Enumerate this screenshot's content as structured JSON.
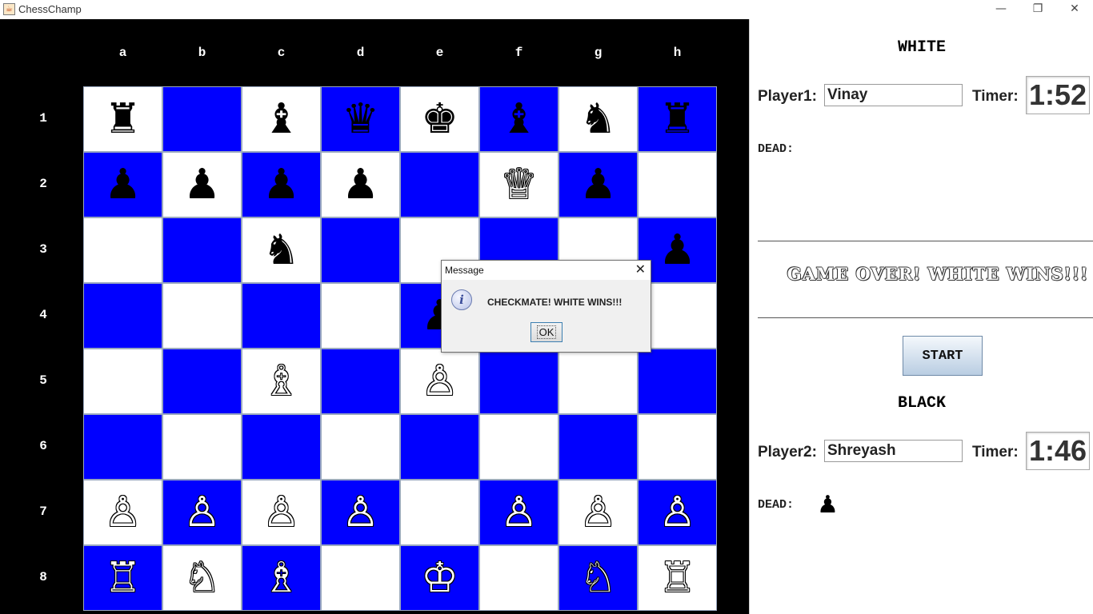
{
  "window": {
    "title": "ChessChamp",
    "app_icon": "java-icon",
    "minimize_glyph": "—",
    "restore_glyph": "❐",
    "close_glyph": "✕"
  },
  "board": {
    "files": [
      "a",
      "b",
      "c",
      "d",
      "e",
      "f",
      "g",
      "h"
    ],
    "ranks": [
      "1",
      "2",
      "3",
      "4",
      "5",
      "6",
      "7",
      "8"
    ],
    "light_color": "#ffffff",
    "dark_color": "#0000ff",
    "squares": [
      [
        "♜",
        "",
        "♝",
        "♛",
        "♚",
        "♝",
        "♞",
        "♜"
      ],
      [
        "♟",
        "♟",
        "♟",
        "♟",
        "",
        "♕",
        "♟",
        ""
      ],
      [
        "",
        "",
        "♞",
        "",
        "",
        "",
        "",
        "♟"
      ],
      [
        "",
        "",
        "",
        "",
        "♟",
        "",
        "",
        ""
      ],
      [
        "",
        "",
        "♗",
        "",
        "♙",
        "",
        "",
        ""
      ],
      [
        "",
        "",
        "",
        "",
        "",
        "",
        "",
        ""
      ],
      [
        "♙",
        "♙",
        "♙",
        "♙",
        "",
        "♙",
        "♙",
        "♙"
      ],
      [
        "♖",
        "♘",
        "♗",
        "",
        "♔",
        "",
        "♘",
        "♖"
      ]
    ]
  },
  "white_side": {
    "title": "WHITE",
    "player_label": "Player1:",
    "player_name": "Vinay",
    "timer_label": "Timer:",
    "timer_value": "1:52",
    "dead_label": "DEAD:",
    "dead_pieces": []
  },
  "status": {
    "game_over_text": "GAME OVER! WHITE WINS!!!"
  },
  "controls": {
    "start_label": "START"
  },
  "black_side": {
    "title": "BLACK",
    "player_label": "Player2:",
    "player_name": "Shreyash",
    "timer_label": "Timer:",
    "timer_value": "1:46",
    "dead_label": "DEAD:",
    "dead_pieces": [
      "♟"
    ]
  },
  "dialog": {
    "title": "Message",
    "icon": "info-icon",
    "icon_glyph": "i",
    "message": "CHECKMATE! WHITE WINS!!!",
    "ok_label": "OK",
    "close_glyph": "✕"
  }
}
